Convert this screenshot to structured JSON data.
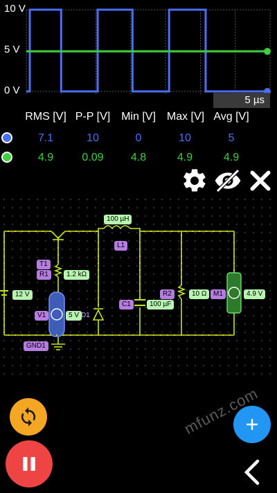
{
  "scope": {
    "y_labels": [
      "10 V",
      "5 V",
      "0 V"
    ],
    "time_per_div": "5 µs"
  },
  "chart_data": {
    "type": "line",
    "title": "",
    "xlabel": "",
    "ylabel": "",
    "y_ticks": [
      "10 V",
      "5 V",
      "0 V"
    ],
    "ylim": [
      0,
      10
    ],
    "time_per_division": "5 µs",
    "grid": true,
    "series": [
      {
        "name": "",
        "color": "#4a6ef5",
        "shape": "square wave",
        "x": [
          0,
          0.4,
          0.4,
          4.0,
          4.0,
          8.2,
          8.2,
          12.2,
          12.2,
          16.4,
          16.4,
          20.6,
          20.6,
          24.4,
          24.4,
          28.0
        ],
        "y": [
          0,
          0,
          10,
          10,
          0,
          0,
          10,
          10,
          0,
          0,
          10,
          10,
          0,
          0,
          0,
          0
        ]
      },
      {
        "name": "",
        "color": "#3ecf3e",
        "shape": "flat",
        "x": [
          0,
          28.0
        ],
        "y": [
          4.9,
          4.9
        ]
      }
    ]
  },
  "table": {
    "headers": [
      "RMS [V]",
      "P-P [V]",
      "Min [V]",
      "Max [V]",
      "Avg [V]"
    ],
    "rows": [
      {
        "color": "#4a6ef5",
        "values": [
          "7.1",
          "10",
          "0",
          "10",
          "5"
        ]
      },
      {
        "color": "#3ecf3e",
        "values": [
          "4.9",
          "0.09",
          "4.8",
          "4.9",
          "4.9"
        ]
      }
    ]
  },
  "toolbar": {
    "settings_icon": "gear-icon",
    "hide_icon": "eye-off-icon",
    "close_icon": "close-icon"
  },
  "circuit": {
    "inductor_value": "100 µH",
    "inductor_name": "L1",
    "transistor_name": "T1",
    "resistor1_name": "R1",
    "resistor1_value": "1.2 kΩ",
    "battery_value": "12 V",
    "source_name": "V1",
    "source_value": "5 V",
    "diode_name": "D1",
    "capacitor_name": "C1",
    "capacitor_value": "100 µF",
    "resistor2_name": "R2",
    "resistor2_value": "10 Ω",
    "meter_name": "M1",
    "meter_value": "4.9 V",
    "ground_name": "GND1"
  },
  "controls": {
    "refresh_icon": "refresh-icon",
    "pause_icon": "pause-icon",
    "add_icon": "plus-icon",
    "back_icon": "chevron-left-icon"
  },
  "watermark": "mfunz.com",
  "colors": {
    "blue": "#4a6ef5",
    "green": "#3ecf3e",
    "wire": "#c8e620",
    "orange": "#f5a623",
    "red": "#ef4444",
    "fab_blue": "#2196f3"
  }
}
